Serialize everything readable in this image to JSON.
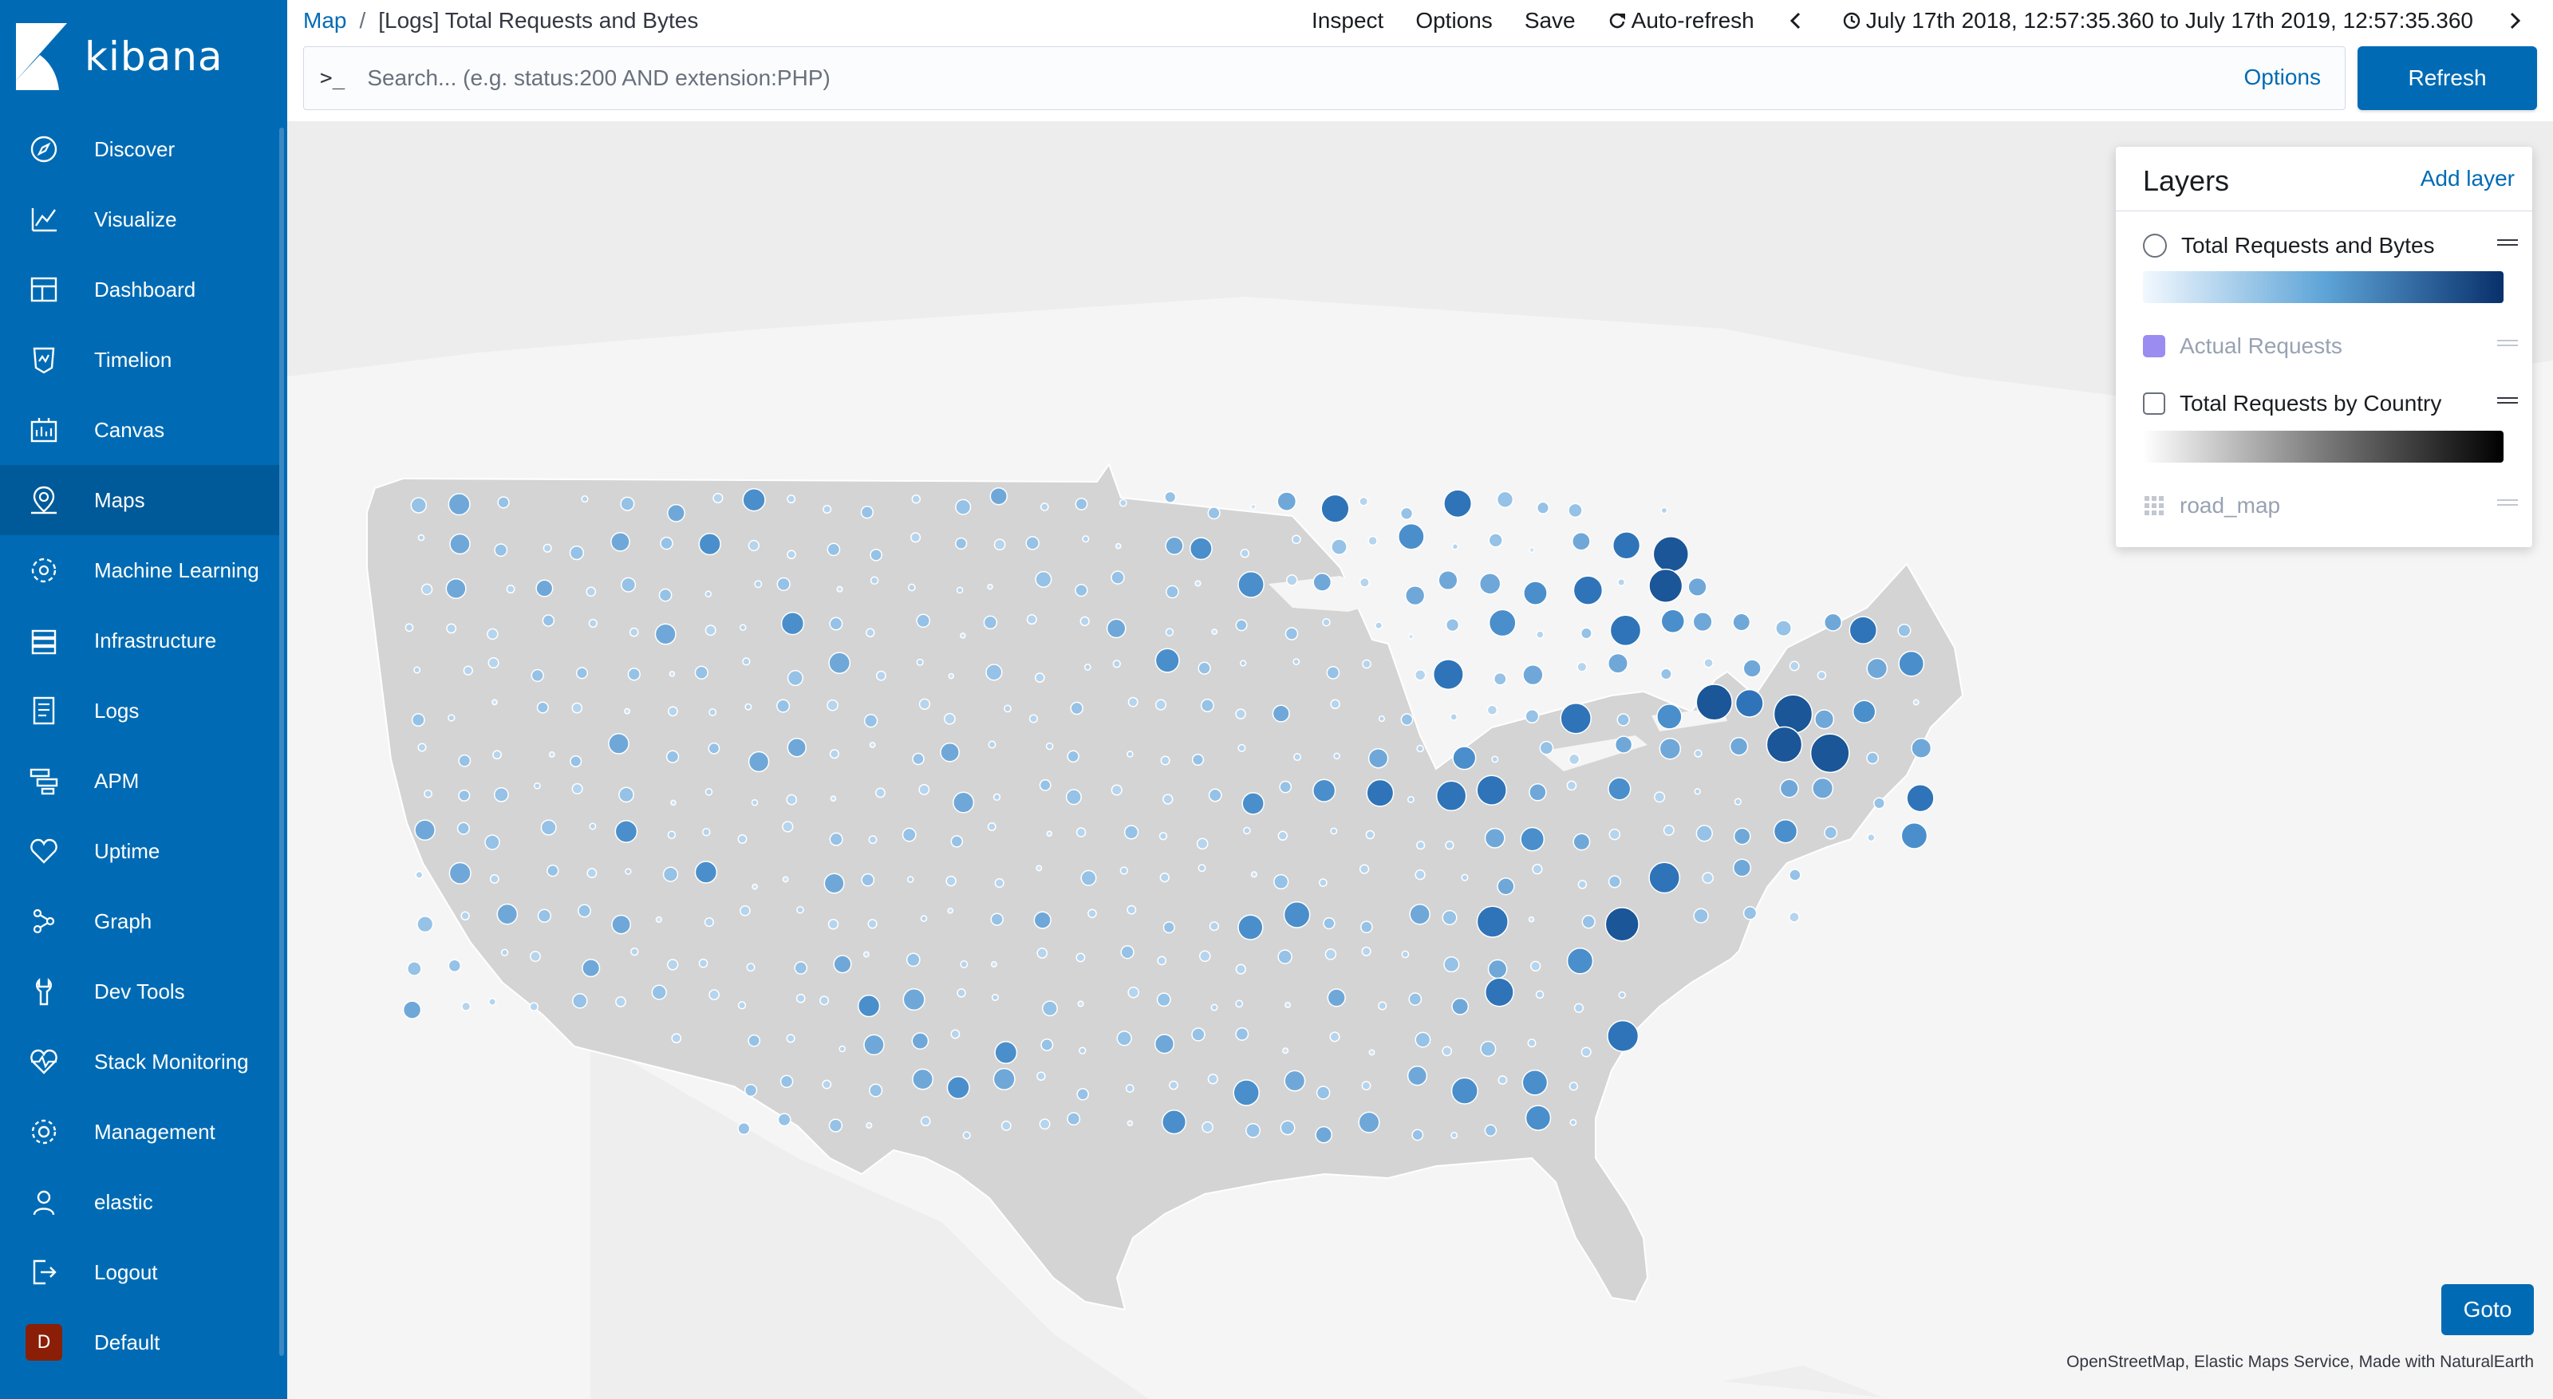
{
  "app": {
    "logo_text": "kibana"
  },
  "sidebar": {
    "items": [
      {
        "label": "Discover",
        "icon": "compass-icon"
      },
      {
        "label": "Visualize",
        "icon": "visualize-icon"
      },
      {
        "label": "Dashboard",
        "icon": "dashboard-icon"
      },
      {
        "label": "Timelion",
        "icon": "timelion-icon"
      },
      {
        "label": "Canvas",
        "icon": "canvas-icon"
      },
      {
        "label": "Maps",
        "icon": "maps-icon",
        "active": true
      },
      {
        "label": "Machine Learning",
        "icon": "machine-learning-icon"
      },
      {
        "label": "Infrastructure",
        "icon": "infrastructure-icon"
      },
      {
        "label": "Logs",
        "icon": "logs-icon"
      },
      {
        "label": "APM",
        "icon": "apm-icon"
      },
      {
        "label": "Uptime",
        "icon": "uptime-icon"
      },
      {
        "label": "Graph",
        "icon": "graph-icon"
      },
      {
        "label": "Dev Tools",
        "icon": "dev-tools-icon"
      },
      {
        "label": "Stack Monitoring",
        "icon": "stack-monitoring-icon"
      },
      {
        "label": "Management",
        "icon": "gear-icon"
      },
      {
        "label": "elastic",
        "icon": "user-icon"
      },
      {
        "label": "Logout",
        "icon": "logout-icon"
      },
      {
        "label": "Default",
        "icon": "space-avatar",
        "avatar_letter": "D"
      }
    ]
  },
  "breadcrumb": {
    "root": "Map",
    "separator": "/",
    "current": "[Logs] Total Requests and Bytes"
  },
  "topmenu": {
    "inspect": "Inspect",
    "options": "Options",
    "save": "Save",
    "auto_refresh": "Auto-refresh",
    "time_range": "July 17th 2018, 12:57:35.360 to July 17th 2019, 12:57:35.360"
  },
  "search": {
    "prompt": ">_",
    "placeholder": "Search... (e.g. status:200 AND extension:PHP)",
    "value": "",
    "options_label": "Options",
    "refresh_label": "Refresh"
  },
  "layers_panel": {
    "title": "Layers",
    "add_layer": "Add layer",
    "layers": [
      {
        "name": "Total Requests and Bytes",
        "control": "radio",
        "visible": true,
        "gradient": [
          "#e3f0fb",
          "#08306b"
        ]
      },
      {
        "name": "Actual Requests",
        "control": "swatch",
        "visible": false,
        "color": "#9b8cf2"
      },
      {
        "name": "Total Requests by Country",
        "control": "checkbox",
        "visible": true,
        "gradient": [
          "#ffffff",
          "#000000"
        ]
      },
      {
        "name": "road_map",
        "control": "grid",
        "visible": false
      }
    ]
  },
  "map": {
    "goto_label": "Goto",
    "attribution": "OpenStreetMap, Elastic Maps Service, Made with NaturalEarth",
    "colors": {
      "land_us": "#d4d4d4",
      "land_other": "#ebebeb",
      "water": "#f5f5f5",
      "low": "#c8dff3",
      "high": "#08306b"
    }
  }
}
